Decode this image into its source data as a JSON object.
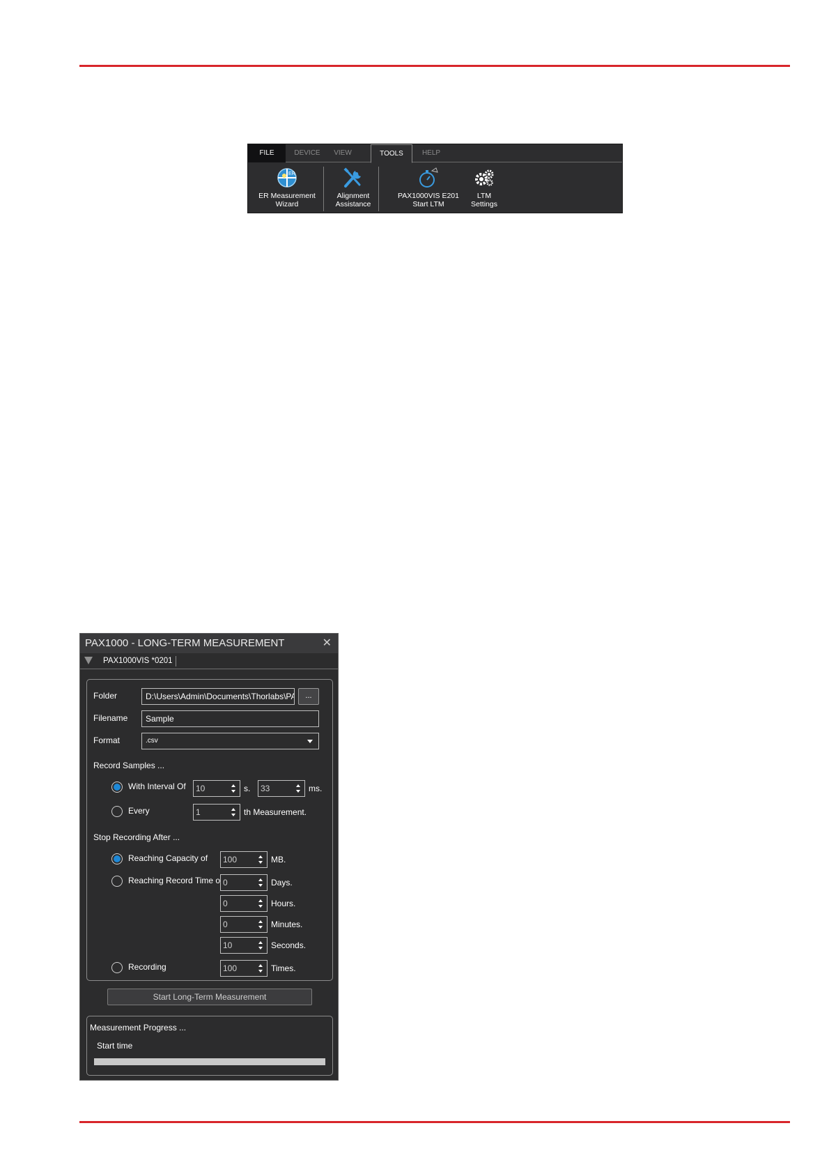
{
  "ribbon": {
    "tabs": [
      "FILE",
      "DEVICE",
      "VIEW",
      "TOOLS",
      "HELP"
    ],
    "active_tab": "TOOLS",
    "tools": [
      {
        "line1": "ER Measurement",
        "line2": "Wizard",
        "icon": "er-wizard-icon"
      },
      {
        "line1": "Alignment",
        "line2": "Assistance",
        "icon": "wrench-screwdriver-icon"
      },
      {
        "line1": "PAX1000VIS E201",
        "line2": "Start LTM",
        "icon": "stopwatch-icon"
      },
      {
        "line1": "LTM",
        "line2": "Settings",
        "icon": "gears-icon"
      }
    ]
  },
  "ltm": {
    "title": "PAX1000 - LONG-TERM MEASUREMENT",
    "close": "✕",
    "device": "PAX1000VIS *0201",
    "folder_label": "Folder",
    "folder_value": "D:\\Users\\Admin\\Documents\\Thorlabs\\PA",
    "browse_label": "...",
    "filename_label": "Filename",
    "filename_value": "Sample",
    "format_label": "Format",
    "format_value": ".csv",
    "record_samples_label": "Record Samples ...",
    "with_interval_label": "With Interval Of",
    "interval_seconds": "10",
    "seconds_unit": "s.",
    "interval_ms": "33",
    "ms_unit": "ms.",
    "every_label": "Every",
    "every_value": "1",
    "every_unit": "th Measurement.",
    "stop_label": "Stop Recording After ...",
    "capacity_label": "Reaching Capacity of",
    "capacity_value": "100",
    "capacity_unit": "MB.",
    "record_time_label": "Reaching Record Time of",
    "days_value": "0",
    "days_unit": "Days.",
    "hours_value": "0",
    "hours_unit": "Hours.",
    "minutes_value": "0",
    "minutes_unit": "Minutes.",
    "seconds_value": "10",
    "seconds_unit_long": "Seconds.",
    "recording_label": "Recording",
    "recording_value": "100",
    "recording_unit": "Times.",
    "start_button": "Start Long-Term Measurement",
    "progress_label": "Measurement Progress ...",
    "start_time_label": "Start time",
    "progress": 0
  },
  "colors": {
    "rule": "#d8262b",
    "radio_selected": "#1e88d6",
    "window_bg": "#2c2c2d"
  }
}
